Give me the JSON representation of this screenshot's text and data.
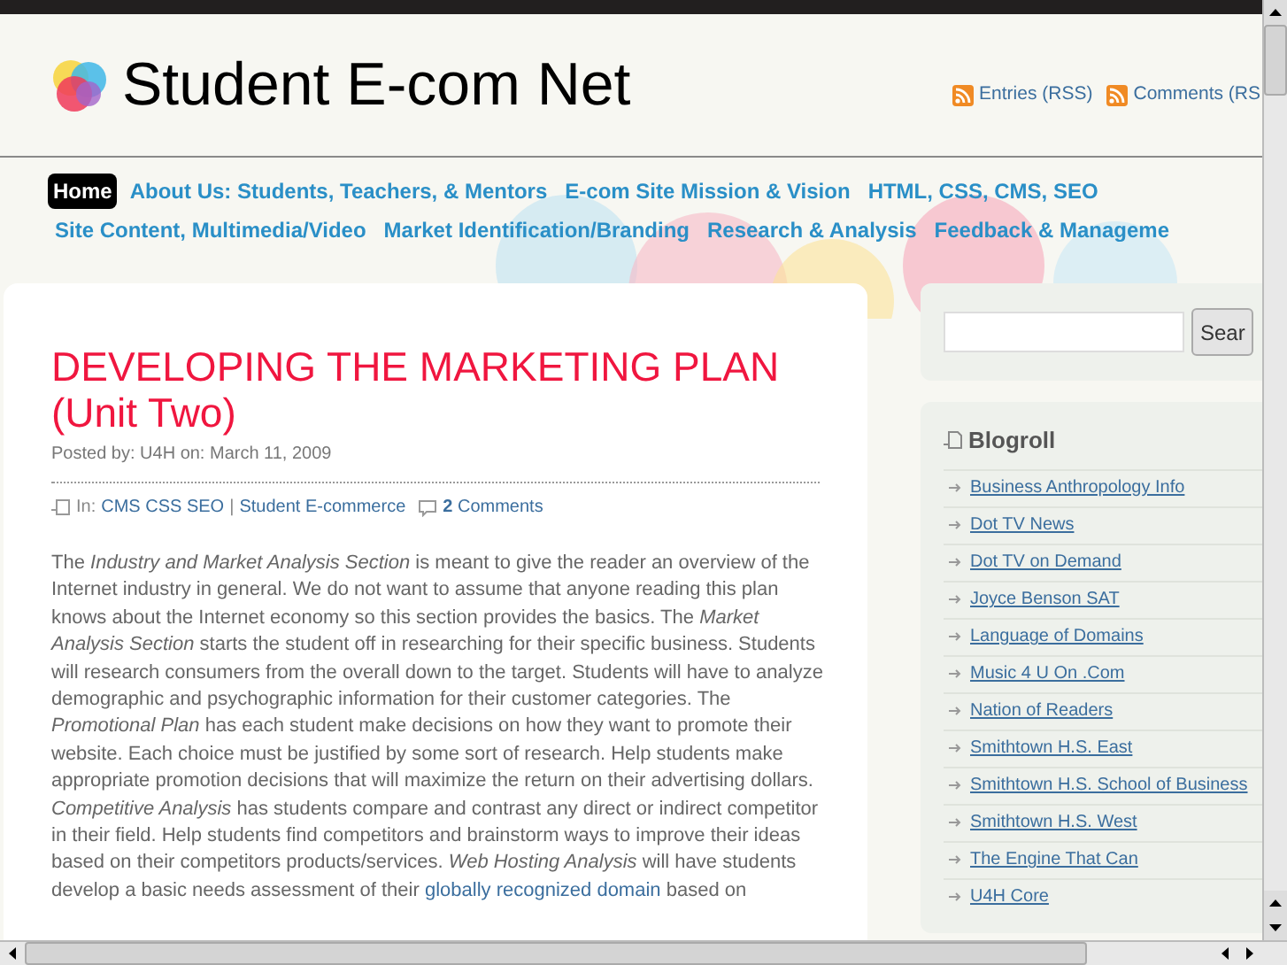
{
  "site": {
    "title": "Student E-com Net",
    "feeds": [
      "Entries (RSS)",
      "Comments (RS"
    ]
  },
  "nav": {
    "rows": [
      [
        {
          "label": "Home",
          "selected": true
        },
        {
          "label": "About Us: Students, Teachers, & Mentors",
          "selected": false
        },
        {
          "label": "E-com Site Mission & Vision",
          "selected": false
        },
        {
          "label": "HTML, CSS, CMS, SEO",
          "selected": false
        }
      ],
      [
        {
          "label": "Site Content, Multimedia/Video",
          "selected": false
        },
        {
          "label": "Market Identification/Branding",
          "selected": false
        },
        {
          "label": "Research & Analysis",
          "selected": false
        },
        {
          "label": "Feedback & Manageme",
          "selected": false
        }
      ]
    ]
  },
  "post": {
    "title": "DEVELOPING THE MARKETING PLAN (Unit Two)",
    "byline": "Posted by: U4H on: March 11, 2009",
    "in_label": "In:",
    "categories": [
      "CMS CSS SEO",
      "Student E-commerce"
    ],
    "separator": "|",
    "comments_count": "2",
    "comments_label": "Comments",
    "body": {
      "before": "The *Industry and Market Analysis Section* is meant to give the reader an overview of the Internet industry in general. We do not want to assume that anyone reading this plan knows about the Internet economy so this section provides the basics. The *Market Analysis Section* starts the student off in researching for their specific business. Students will research consumers from the overall down to the target. Students will have to analyze demographic and psychographic information for their customer categories. The *Promotional Plan* has each student make decisions on how they want to promote their website. Each choice must be justified by some sort of research. Help students make appropriate promotion decisions that will maximize the return on their advertising dollars. *Competitive Analysis* has students compare and contrast any direct or indirect competitor in their field. Help students find competitors and brainstorm ways to improve their ideas based on their competitors products/services. *Web Hosting Analysis* will have students develop a basic needs assessment of their",
      "link": "globally recognized domain",
      "after": "based on"
    }
  },
  "sidebar": {
    "search_button": "Sear",
    "blogroll": {
      "title": "Blogroll",
      "links": [
        "Business Anthropology Info",
        "Dot TV News",
        "Dot TV on Demand",
        "Joyce Benson SAT",
        "Language of Domains",
        "Music 4 U On .Com",
        "Nation of Readers",
        "Smithtown H.S. East",
        "Smithtown H.S. School of Business",
        "Smithtown H.S. West",
        "The Engine That Can",
        "U4H Core"
      ]
    }
  }
}
